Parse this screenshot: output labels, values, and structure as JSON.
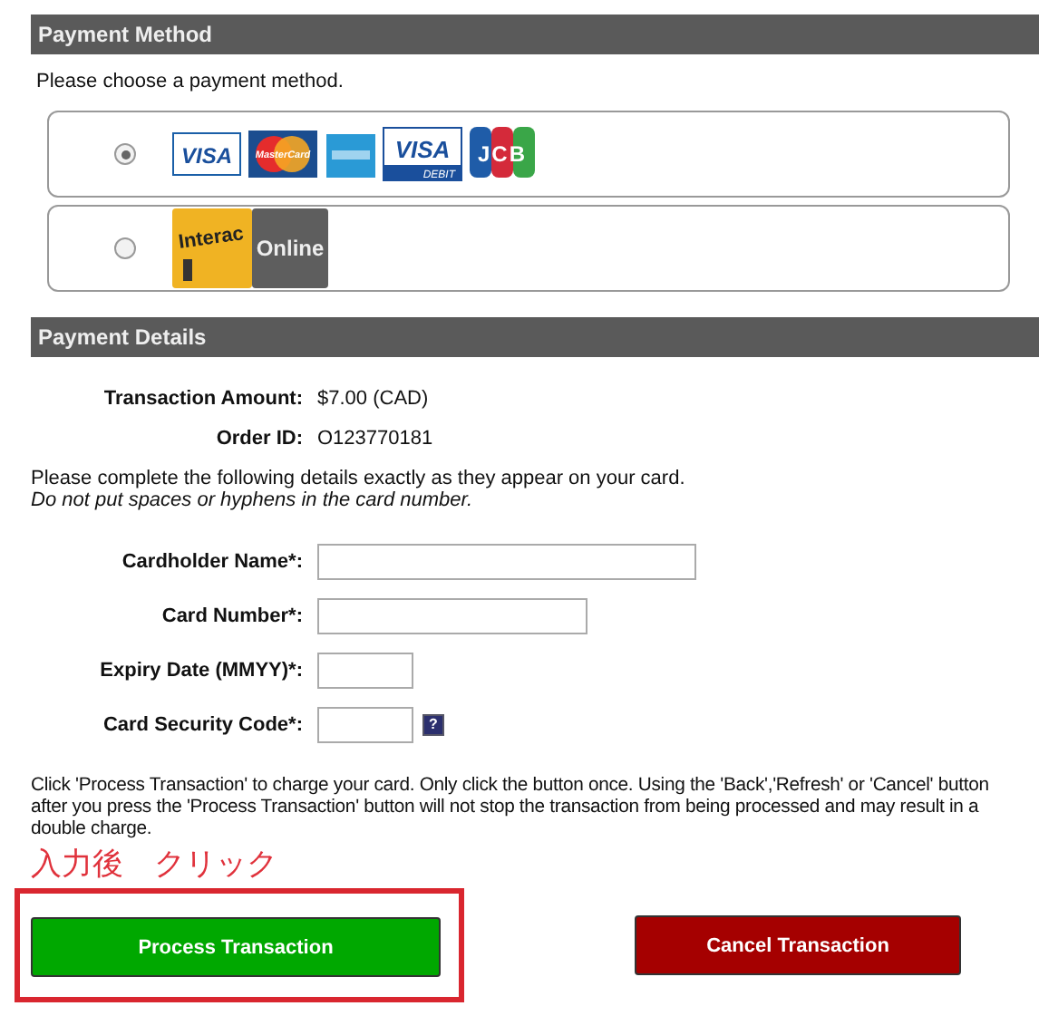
{
  "payment_method": {
    "title": "Payment Method",
    "prompt": "Please choose a payment method.",
    "options": [
      {
        "selected": true,
        "logos": [
          {
            "kind": "visa",
            "text": "VISA"
          },
          {
            "kind": "mastercard",
            "text": "MasterCard"
          },
          {
            "kind": "amex"
          },
          {
            "kind": "visa_debit",
            "text": "VISA",
            "subtext": "DEBIT"
          },
          {
            "kind": "jcb",
            "text": "JCB"
          }
        ]
      },
      {
        "selected": false,
        "logos": [
          {
            "kind": "interac",
            "text": "Interac",
            "subtext": "Online"
          }
        ]
      }
    ]
  },
  "payment_details": {
    "title": "Payment Details",
    "summary": [
      {
        "label": "Transaction Amount:",
        "value": "$7.00 (CAD)"
      },
      {
        "label": "Order ID:",
        "value": "O123770181"
      }
    ],
    "instructions": "Please complete the following details exactly as they appear on your card.",
    "hint": "Do not put spaces or hyphens in the card number.",
    "fields": [
      {
        "label": "Cardholder Name*:",
        "kind": "long"
      },
      {
        "label": "Card Number*:",
        "kind": "medium"
      },
      {
        "label": "Expiry Date (MMYY)*:",
        "kind": "short"
      },
      {
        "label": "Card Security Code*:",
        "kind": "short",
        "help": "?"
      }
    ],
    "note": "Click 'Process Transaction' to charge your card. Only click the button once. Using the 'Back','Refresh' or 'Cancel' button after you press the 'Process Transaction' button will not stop the transaction from being processed and may result in a double charge.",
    "annotation": "入力後　クリック",
    "buttons": [
      {
        "label": "Process Transaction",
        "kind": "primary",
        "highlighted": true
      },
      {
        "label": "Cancel Transaction",
        "kind": "cancel",
        "highlighted": false
      }
    ]
  }
}
